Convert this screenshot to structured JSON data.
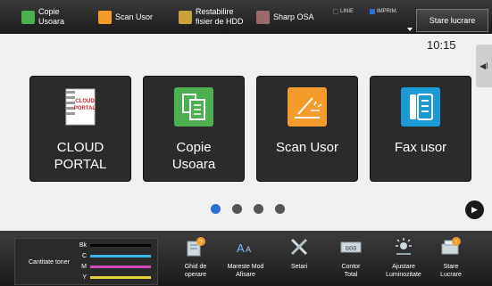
{
  "topbar": {
    "copie_usoara": "Copie\nUsoara",
    "scan_usor": "Scan Usor",
    "restabilire": "Restabilire\nfisier de HDD",
    "sharp_osa": "Sharp OSA",
    "linie": "LINIE",
    "imprim": "IMPRIM.",
    "stare_lucrare": "Stare lucrare"
  },
  "main": {
    "clock": "10:15",
    "tiles": [
      {
        "label": "CLOUD PORTAL",
        "icon": "cloud-portal-icon"
      },
      {
        "label": "Copie\nUsoara",
        "icon": "copy-icon"
      },
      {
        "label": "Scan Usor",
        "icon": "scanner-icon"
      },
      {
        "label": "Fax usor",
        "icon": "fax-icon"
      }
    ],
    "page_dots": 4,
    "active_page": 1
  },
  "bottombar": {
    "toner_label": "Cantitate toner",
    "toner": [
      {
        "name": "Bk",
        "color": "#000000"
      },
      {
        "name": "C",
        "color": "#3bb6e8"
      },
      {
        "name": "M",
        "color": "#d14bb8"
      },
      {
        "name": "Y",
        "color": "#e2d13c"
      }
    ],
    "items": [
      {
        "label": "Ghid de\noperare",
        "icon": "guide-icon"
      },
      {
        "label": "Mareste Mod\nAfisare",
        "icon": "enlarge-display-icon"
      },
      {
        "label": "Setari",
        "icon": "settings-icon"
      },
      {
        "label": "Contor\nTotal",
        "icon": "counter-icon"
      },
      {
        "label": "Ajustare\nLuminozitate",
        "icon": "brightness-icon"
      },
      {
        "label": "Stare\nLucrare",
        "icon": "job-status-icon"
      }
    ]
  },
  "colors": {
    "accent": "#2a6ed8",
    "copy_green": "#4caf50",
    "scan_orange": "#f39c2b",
    "fax_teal": "#1c9ad6",
    "cloud_red": "#c8242b"
  }
}
